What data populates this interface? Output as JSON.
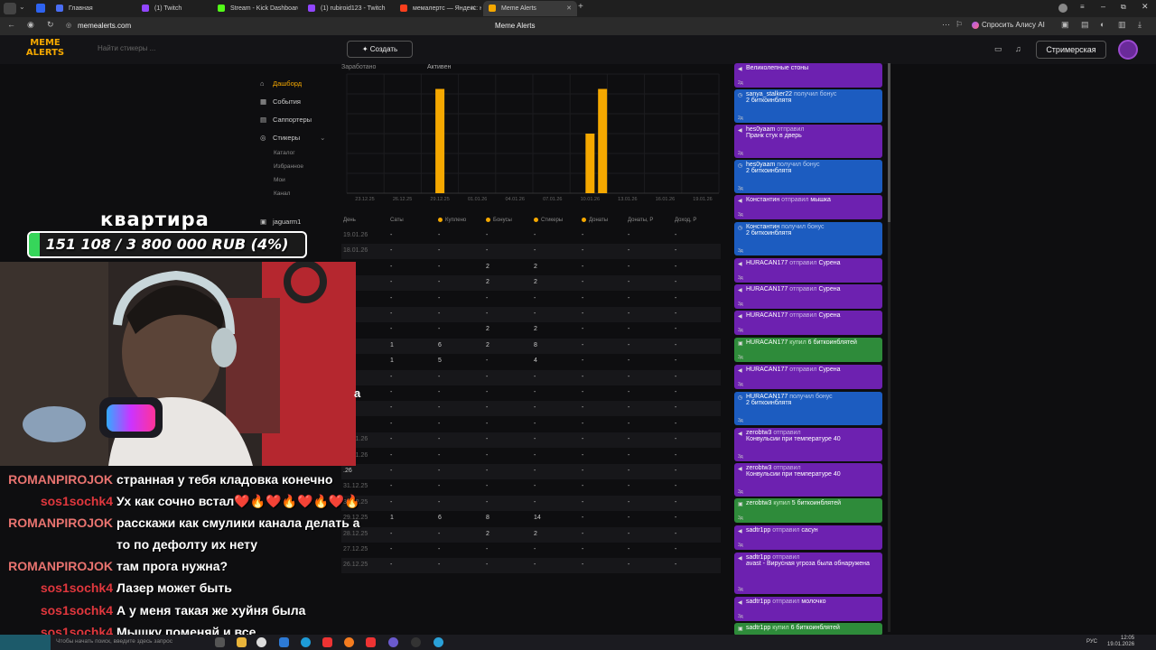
{
  "browser": {
    "tabs": [
      {
        "label": "Главная",
        "color": "#4a6ef5"
      },
      {
        "label": "(1) Twitch",
        "color": "#9146ff"
      },
      {
        "label": "Stream - Kick Dashboard",
        "color": "#53fc18"
      },
      {
        "label": "(1) rubiroid123 - Twitch",
        "color": "#9146ff"
      },
      {
        "label": "мемалертс — Яндекс: на",
        "color": "#fc3f1d"
      },
      {
        "label": "Meme Alerts",
        "color": "#f5a800"
      }
    ],
    "url": "memealerts.com",
    "page_title": "Meme Alerts",
    "alice_label": "Спросить Алису AI"
  },
  "app": {
    "logo_line1": "MEME",
    "logo_line2": "ALERTS",
    "search_placeholder": "Найти стикеры ...",
    "create_label": "Создать",
    "streamer_label": "Стримерская"
  },
  "nav": {
    "items": [
      {
        "label": "Дашборд",
        "icon": "home-icon"
      },
      {
        "label": "События",
        "icon": "events-icon"
      },
      {
        "label": "Саппортеры",
        "icon": "supporters-icon"
      },
      {
        "label": "Стикеры",
        "icon": "stickers-icon"
      }
    ],
    "sub_items": [
      "Каталог",
      "Избранное",
      "Мои",
      "Канал"
    ],
    "user": "jaguarm1"
  },
  "chart_data": {
    "type": "bar",
    "tabs": [
      "Заработано",
      "Активен"
    ],
    "categories": [
      "23.12.25",
      "26.12.25",
      "29.12.25",
      "01.01.26",
      "04.01.26",
      "07.01.26",
      "10.01.26",
      "13.01.26",
      "16.01.26",
      "19.01.26"
    ],
    "bars": [
      {
        "date": "29.12.25",
        "value": 14
      },
      {
        "date": "10.01.26",
        "value": 8
      },
      {
        "date": "11.01.26",
        "value": 14
      }
    ],
    "ylim": [
      0,
      16
    ],
    "bar_color": "#f5a800"
  },
  "table": {
    "headers": [
      "День",
      "Саты",
      "Куплено",
      "Бонусы",
      "Стикеры",
      "Донаты",
      "Донаты, Р",
      "Доход, Р"
    ],
    "rows": [
      [
        "19.01.26",
        "-",
        "-",
        "-",
        "-",
        "-",
        "-",
        "-"
      ],
      [
        "18.01.26",
        "-",
        "-",
        "-",
        "-",
        "-",
        "-",
        "-"
      ],
      [
        ".26",
        "-",
        "-",
        "2",
        "2",
        "-",
        "-",
        "-"
      ],
      [
        ".26",
        "-",
        "-",
        "2",
        "2",
        "-",
        "-",
        "-"
      ],
      [
        ".26",
        "-",
        "-",
        "-",
        "-",
        "-",
        "-",
        "-"
      ],
      [
        ".26",
        "-",
        "-",
        "-",
        "-",
        "-",
        "-",
        "-"
      ],
      [
        ".26",
        "-",
        "-",
        "2",
        "2",
        "-",
        "-",
        "-"
      ],
      [
        ".26",
        "1",
        "6",
        "2",
        "8",
        "-",
        "-",
        "-"
      ],
      [
        ".26",
        "1",
        "5",
        "-",
        "4",
        "-",
        "-",
        "-"
      ],
      [
        ".26",
        "-",
        "-",
        "-",
        "-",
        "-",
        "-",
        "-"
      ],
      [
        ".26",
        "-",
        "-",
        "-",
        "-",
        "-",
        "-",
        "-"
      ],
      [
        ".26",
        "-",
        "-",
        "-",
        "-",
        "-",
        "-",
        "-"
      ],
      [
        ".26",
        "-",
        "-",
        "-",
        "-",
        "-",
        "-",
        "-"
      ],
      [
        "04.01.26",
        "-",
        "-",
        "-",
        "-",
        "-",
        "-",
        "-"
      ],
      [
        "03.01.26",
        "-",
        "-",
        "-",
        "-",
        "-",
        "-",
        "-"
      ],
      [
        ".26",
        "-",
        "-",
        "-",
        "-",
        "-",
        "-",
        "-"
      ],
      [
        "31.12.25",
        "-",
        "-",
        "-",
        "-",
        "-",
        "-",
        "-"
      ],
      [
        "30.12.25",
        "-",
        "-",
        "-",
        "-",
        "-",
        "-",
        "-"
      ],
      [
        "29.12.25",
        "1",
        "6",
        "8",
        "14",
        "-",
        "-",
        "-"
      ],
      [
        "28.12.25",
        "-",
        "-",
        "2",
        "2",
        "-",
        "-",
        "-"
      ],
      [
        "27.12.25",
        "-",
        "-",
        "-",
        "-",
        "-",
        "-",
        "-"
      ],
      [
        "26.12.25",
        "-",
        "-",
        "-",
        "-",
        "-",
        "-",
        "-"
      ]
    ]
  },
  "feed": [
    {
      "color": "purple",
      "user": "",
      "verb": "",
      "line2": "Великолепные стоны",
      "time": "2д"
    },
    {
      "color": "blue",
      "user": "sanya_stalker22",
      "verb": "получил бонус",
      "line2": "2 биткоинблятя",
      "time": "2д"
    },
    {
      "color": "purple",
      "user": "hes0yaam",
      "verb": "отправил",
      "line2": "Пранк стук в дверь",
      "time": "2д"
    },
    {
      "color": "blue",
      "user": "hes0yaam",
      "verb": "получил бонус",
      "line2": "2 биткоинблятя",
      "time": "3д"
    },
    {
      "color": "purple",
      "user": "Константин",
      "verb": "отправил",
      "inline": "мышка",
      "time": "3д"
    },
    {
      "color": "blue",
      "user": "Константин",
      "verb": "получил бонус",
      "line2": "2 биткоинблятя",
      "time": "3д"
    },
    {
      "color": "purple",
      "user": "HURACAN177",
      "verb": "отправил",
      "inline": "Сурена",
      "time": "3д"
    },
    {
      "color": "purple",
      "user": "HURACAN177",
      "verb": "отправил",
      "inline": "Сурена",
      "time": "3д"
    },
    {
      "color": "purple",
      "user": "HURACAN177",
      "verb": "отправил",
      "inline": "Сурена",
      "time": "3д"
    },
    {
      "color": "green",
      "user": "HURACAN177",
      "verb": "купил",
      "inline": "6 биткоинблятей",
      "time": "3д"
    },
    {
      "color": "purple",
      "user": "HURACAN177",
      "verb": "отправил",
      "inline": "Сурена",
      "time": "3д"
    },
    {
      "color": "blue",
      "user": "HURACAN177",
      "verb": "получил бонус",
      "line2": "2 биткоинблятя",
      "time": "3д"
    },
    {
      "color": "purple",
      "user": "zerobtw3",
      "verb": "отправил",
      "line2": "Конвульсии при температуре 40",
      "time": "3д"
    },
    {
      "color": "purple",
      "user": "zerobtw3",
      "verb": "отправил",
      "line2": "Конвульсии при температуре 40",
      "time": "3д"
    },
    {
      "color": "green",
      "user": "zerobtw3",
      "verb": "купил",
      "inline": "5 биткоинблятей",
      "time": "3д"
    },
    {
      "color": "purple",
      "user": "sadtr1pp",
      "verb": "отправил",
      "inline": "сасун",
      "time": "3д"
    },
    {
      "color": "purple",
      "user": "sadtr1pp",
      "verb": "отправил",
      "line2": "avast - Вирусная угроза была обнаружена",
      "time": "3д"
    },
    {
      "color": "purple",
      "user": "sadtr1pp",
      "verb": "отправил",
      "inline": "молочко",
      "time": "3д"
    },
    {
      "color": "green",
      "user": "sadtr1pp",
      "verb": "купил",
      "inline": "6 биткоинблятей",
      "time": ""
    }
  ],
  "overlay": {
    "goal_title": "квартира",
    "goal_text": "151 108 / 3 800 000 RUB (4%)",
    "goal_progress": 0.04,
    "stray_text": "а",
    "chat": [
      {
        "user": "ROMANPIROJOK",
        "style": "a",
        "msg": "странная у тебя кладовка конечно"
      },
      {
        "user": "sos1sochk4",
        "style": "b",
        "msg": "Ух как сочно встал❤️🔥❤️🔥❤️🔥❤️🔥"
      },
      {
        "user": "ROMANPIROJOK",
        "style": "a",
        "msg": "расскажи как смулики канала делать а"
      },
      {
        "user": "",
        "style": "a",
        "msg": "то по дефолту их нету"
      },
      {
        "user": "ROMANPIROJOK",
        "style": "a",
        "msg": "там прога нужна?"
      },
      {
        "user": "sos1sochk4",
        "style": "b",
        "msg": "Лазер может быть"
      },
      {
        "user": "sos1sochk4",
        "style": "b",
        "msg": "А у меня такая же хуйня была"
      },
      {
        "user": "sos1sochk4",
        "style": "b",
        "msg": "Мышку поменяй и все"
      }
    ]
  },
  "taskbar": {
    "search_placeholder": "Чтобы начать поиск, введите здесь запрос",
    "lang": "РУС",
    "time": "12:05",
    "date": "19.01.2026"
  }
}
